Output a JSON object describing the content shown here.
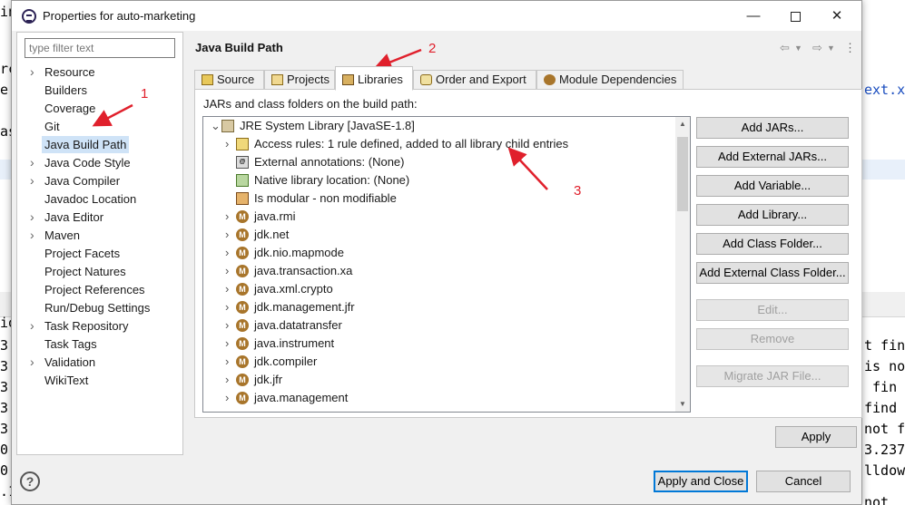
{
  "background_editor": {
    "lines_left": [
      "in",
      "rc",
      "e(",
      "as",
      "io",
      "3,",
      "3,",
      "3,",
      "3,",
      "3,",
      "0,",
      "0,",
      ".1"
    ],
    "lines_right": [
      "ext.x",
      "t fin",
      "is no",
      " fin",
      "find",
      "not f",
      "3.237",
      "lldow",
      "not"
    ]
  },
  "window": {
    "title": "Properties for auto-marketing",
    "minimize": "—",
    "close": "✕"
  },
  "filter": {
    "placeholder": "type filter text"
  },
  "nav": {
    "items": [
      {
        "label": "Resource",
        "expandable": true
      },
      {
        "label": "Builders",
        "expandable": false
      },
      {
        "label": "Coverage",
        "expandable": false
      },
      {
        "label": "Git",
        "expandable": false
      },
      {
        "label": "Java Build Path",
        "expandable": false,
        "selected": true
      },
      {
        "label": "Java Code Style",
        "expandable": true
      },
      {
        "label": "Java Compiler",
        "expandable": true
      },
      {
        "label": "Javadoc Location",
        "expandable": false
      },
      {
        "label": "Java Editor",
        "expandable": true
      },
      {
        "label": "Maven",
        "expandable": true
      },
      {
        "label": "Project Facets",
        "expandable": false
      },
      {
        "label": "Project Natures",
        "expandable": false
      },
      {
        "label": "Project References",
        "expandable": false
      },
      {
        "label": "Run/Debug Settings",
        "expandable": false
      },
      {
        "label": "Task Repository",
        "expandable": true
      },
      {
        "label": "Task Tags",
        "expandable": false
      },
      {
        "label": "Validation",
        "expandable": true
      },
      {
        "label": "WikiText",
        "expandable": false
      }
    ]
  },
  "page": {
    "title": "Java Build Path"
  },
  "tabs": [
    {
      "label": "Source",
      "icon": "source-folder-icon"
    },
    {
      "label": "Projects",
      "icon": "projects-icon"
    },
    {
      "label": "Libraries",
      "icon": "libraries-icon",
      "active": true
    },
    {
      "label": "Order and Export",
      "icon": "order-export-icon"
    },
    {
      "label": "Module Dependencies",
      "icon": "module-icon"
    }
  ],
  "libraries": {
    "label": "JARs and class folders on the build path:",
    "tree": [
      {
        "label": "JRE System Library [JavaSE-1.8]",
        "level": 0,
        "twisty": "open",
        "icon": "jre-library-icon"
      },
      {
        "label": "Access rules: 1 rule defined, added to all library child entries",
        "level": 1,
        "twisty": "closed",
        "icon": "access-rules-icon"
      },
      {
        "label": "External annotations: (None)",
        "level": 1,
        "twisty": "none",
        "icon": "external-annotations-icon"
      },
      {
        "label": "Native library location: (None)",
        "level": 1,
        "twisty": "none",
        "icon": "native-library-icon"
      },
      {
        "label": "Is modular - non modifiable",
        "level": 1,
        "twisty": "none",
        "icon": "modular-icon"
      },
      {
        "label": "java.rmi",
        "level": 1,
        "twisty": "closed",
        "icon": "jar-icon"
      },
      {
        "label": "jdk.net",
        "level": 1,
        "twisty": "closed",
        "icon": "jar-icon"
      },
      {
        "label": "jdk.nio.mapmode",
        "level": 1,
        "twisty": "closed",
        "icon": "jar-icon"
      },
      {
        "label": "java.transaction.xa",
        "level": 1,
        "twisty": "closed",
        "icon": "jar-icon"
      },
      {
        "label": "java.xml.crypto",
        "level": 1,
        "twisty": "closed",
        "icon": "jar-icon"
      },
      {
        "label": "jdk.management.jfr",
        "level": 1,
        "twisty": "closed",
        "icon": "jar-icon"
      },
      {
        "label": "java.datatransfer",
        "level": 1,
        "twisty": "closed",
        "icon": "jar-icon"
      },
      {
        "label": "java.instrument",
        "level": 1,
        "twisty": "closed",
        "icon": "jar-icon"
      },
      {
        "label": "jdk.compiler",
        "level": 1,
        "twisty": "closed",
        "icon": "jar-icon"
      },
      {
        "label": "jdk.jfr",
        "level": 1,
        "twisty": "closed",
        "icon": "jar-icon"
      },
      {
        "label": "java.management",
        "level": 1,
        "twisty": "closed",
        "icon": "jar-icon"
      }
    ]
  },
  "buttons": {
    "add_jars": "Add JARs...",
    "add_external_jars": "Add External JARs...",
    "add_variable": "Add Variable...",
    "add_library": "Add Library...",
    "add_class_folder": "Add Class Folder...",
    "add_external_class_folder": "Add External Class Folder...",
    "edit": "Edit...",
    "remove": "Remove",
    "migrate_jar": "Migrate JAR File...",
    "apply": "Apply",
    "apply_and_close": "Apply and Close",
    "cancel": "Cancel"
  },
  "annotations": [
    "1",
    "2",
    "3"
  ],
  "colors": {
    "annotation": "#e0202c",
    "selection": "#cfe3f7",
    "default_button_border": "#0078d7"
  }
}
